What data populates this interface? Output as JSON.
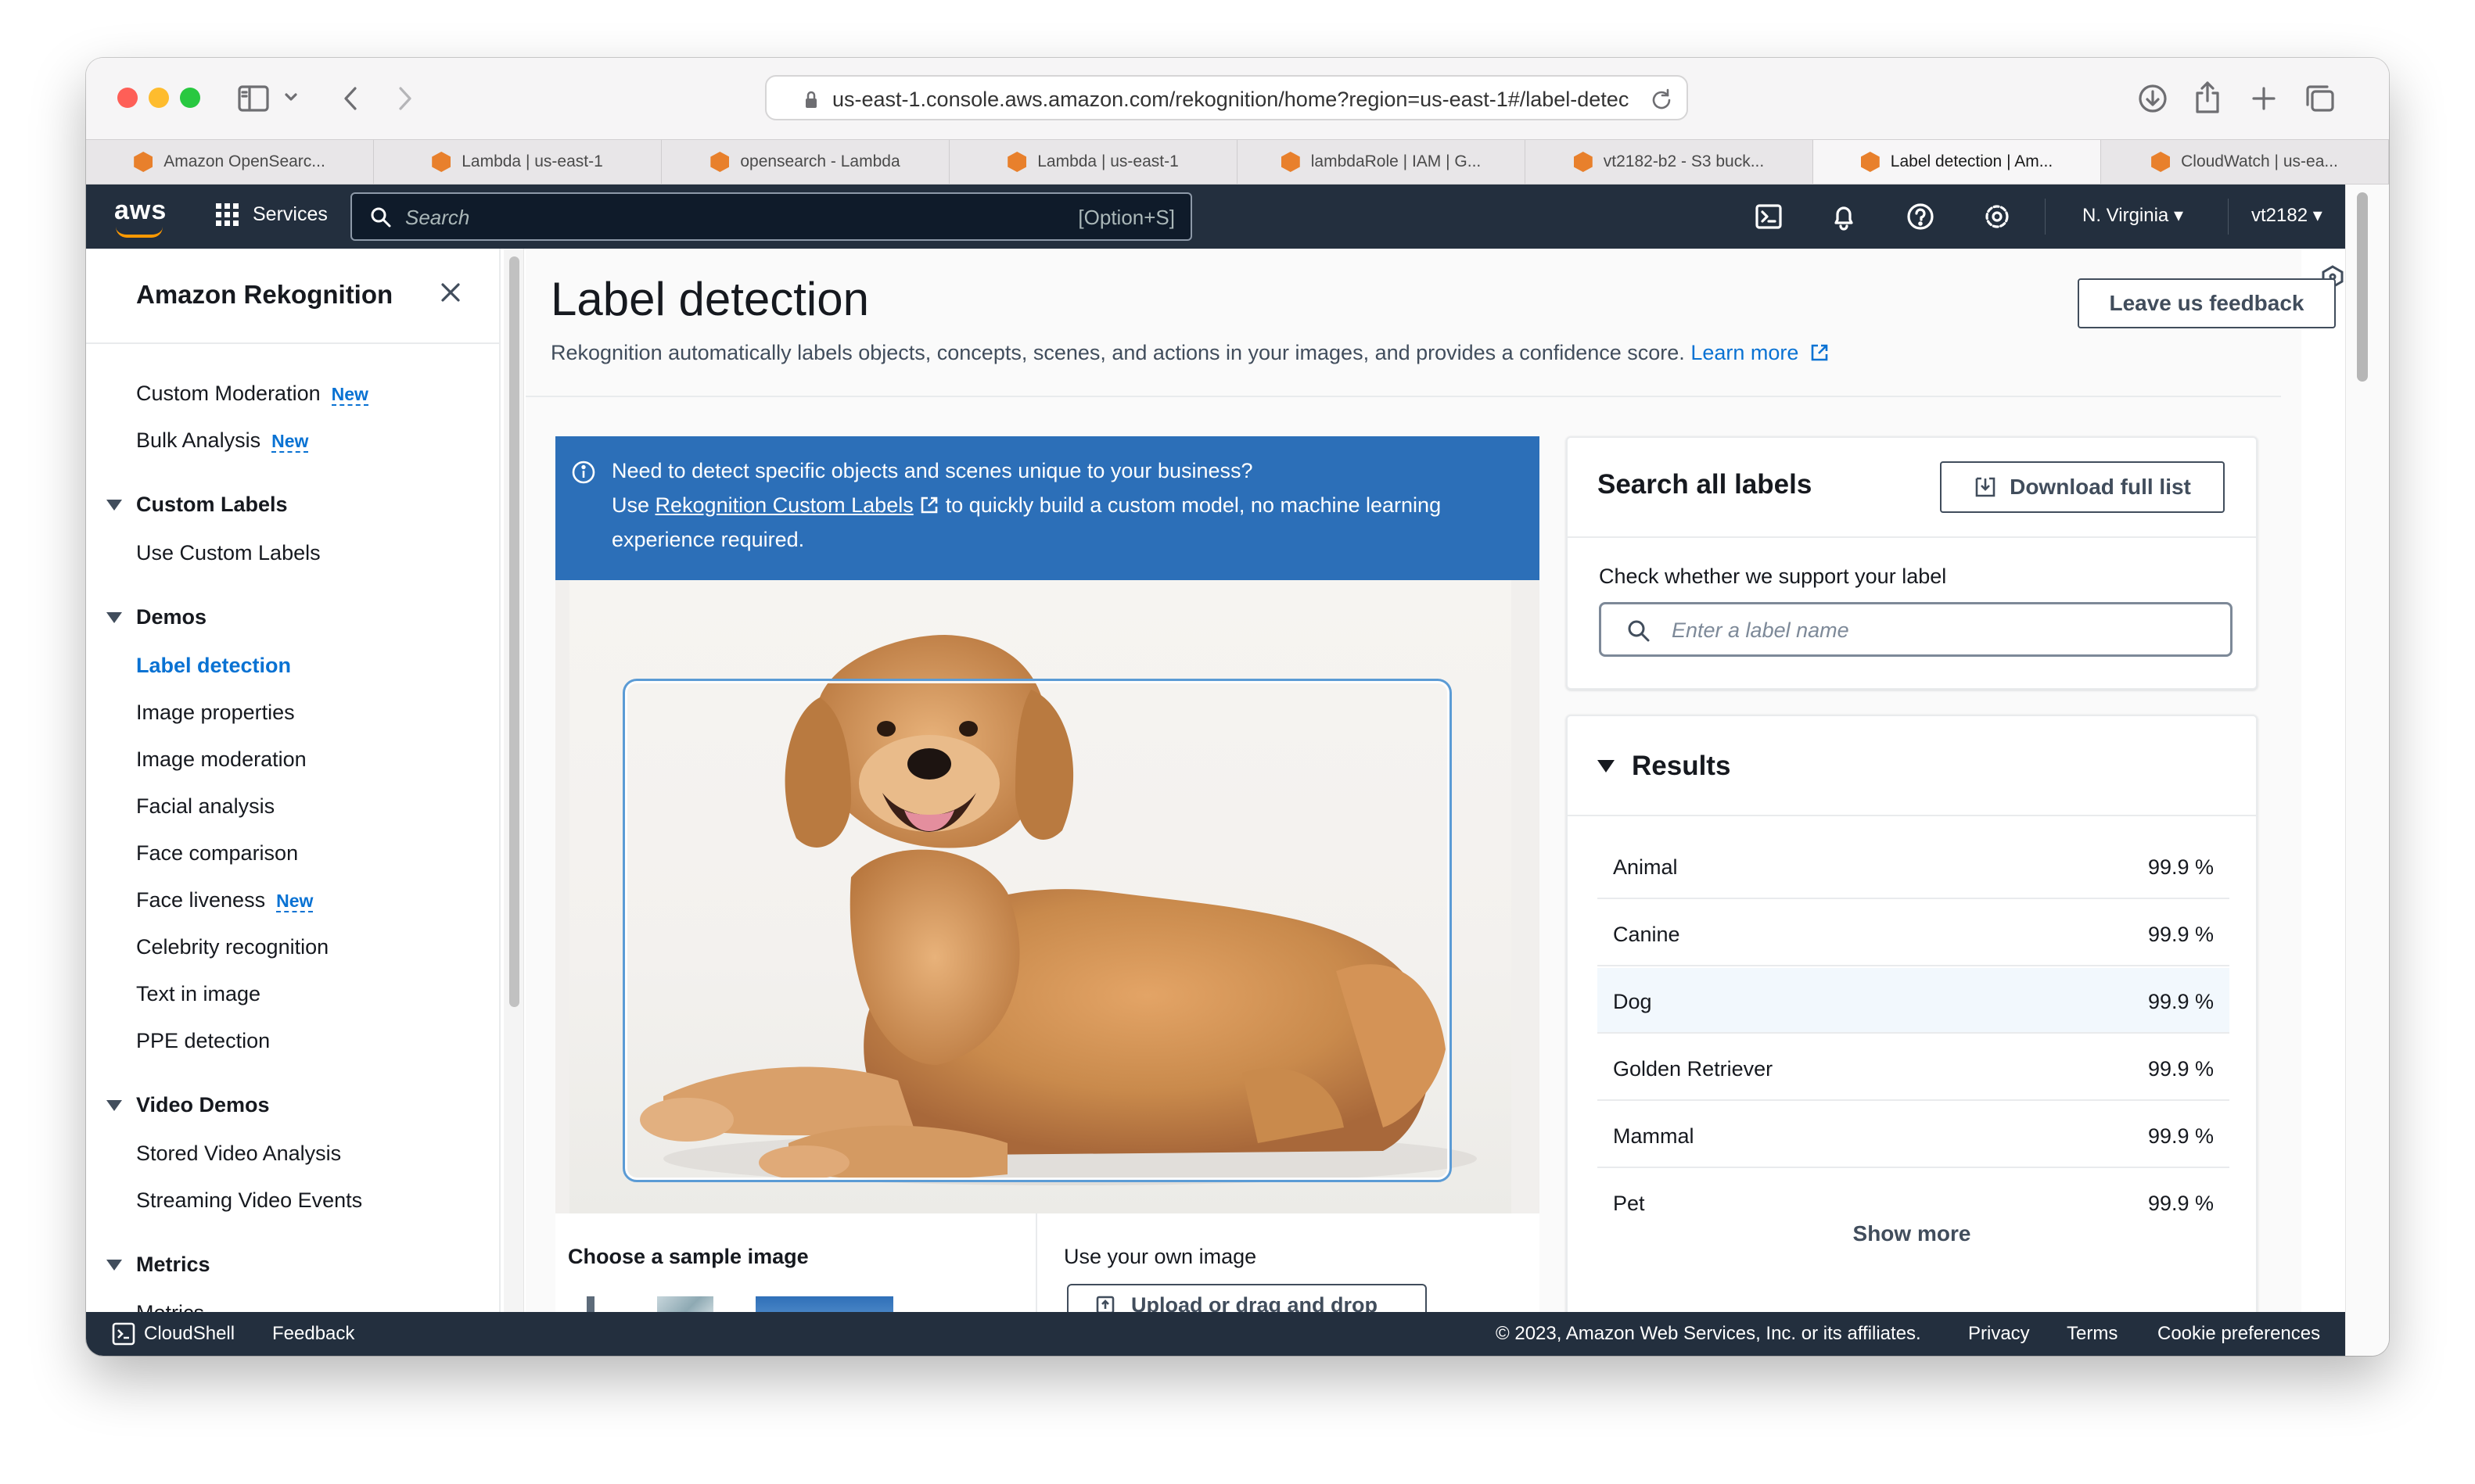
{
  "browser": {
    "url": "us-east-1.console.aws.amazon.com/rekognition/home?region=us-east-1#/label-detec",
    "tabs": [
      {
        "label": "Amazon OpenSearc..."
      },
      {
        "label": "Lambda | us-east-1"
      },
      {
        "label": "opensearch - Lambda"
      },
      {
        "label": "Lambda | us-east-1"
      },
      {
        "label": "lambdaRole | IAM | G..."
      },
      {
        "label": "vt2182-b2 - S3 buck..."
      },
      {
        "label": "Label detection | Am..."
      },
      {
        "label": "CloudWatch | us-ea..."
      }
    ],
    "active_tab_index": 6
  },
  "aws_nav": {
    "logo": "aws",
    "services_label": "Services",
    "search_placeholder": "Search",
    "search_shortcut": "[Option+S]",
    "region": "N. Virginia",
    "account": "vt2182",
    "icons": [
      "cloudshell-icon",
      "bell-icon",
      "help-icon",
      "settings-icon"
    ]
  },
  "sidebar": {
    "title": "Amazon Rekognition",
    "items_top": [
      {
        "label": "Custom Moderation",
        "badge": "New"
      },
      {
        "label": "Bulk Analysis",
        "badge": "New"
      }
    ],
    "sections": [
      {
        "heading": "Custom Labels",
        "items": [
          {
            "label": "Use Custom Labels"
          }
        ]
      },
      {
        "heading": "Demos",
        "items": [
          {
            "label": "Label detection",
            "active": true
          },
          {
            "label": "Image properties"
          },
          {
            "label": "Image moderation"
          },
          {
            "label": "Facial analysis"
          },
          {
            "label": "Face comparison"
          },
          {
            "label": "Face liveness",
            "badge": "New"
          },
          {
            "label": "Celebrity recognition"
          },
          {
            "label": "Text in image"
          },
          {
            "label": "PPE detection"
          }
        ]
      },
      {
        "heading": "Video Demos",
        "items": [
          {
            "label": "Stored Video Analysis"
          },
          {
            "label": "Streaming Video Events"
          }
        ]
      },
      {
        "heading": "Metrics",
        "items": [
          {
            "label": "Metrics"
          }
        ]
      }
    ]
  },
  "page": {
    "title": "Label detection",
    "description": "Rekognition automatically labels objects, concepts, scenes, and actions in your images, and provides a confidence score.",
    "learn_more": "Learn more",
    "feedback_button": "Leave us feedback"
  },
  "info_banner": {
    "line1": "Need to detect specific objects and scenes unique to your business?",
    "line2_pre": "Use",
    "line2_link": "Rekognition Custom Labels",
    "line2_post": "to quickly build a custom model, no machine learning",
    "line3": "experience required."
  },
  "sample_section": {
    "choose_label": "Choose a sample image",
    "own_label": "Use your own image",
    "upload_button": "Upload or drag and drop"
  },
  "search_card": {
    "title": "Search all labels",
    "download_button": "Download full list",
    "check_label": "Check whether we support your label",
    "input_placeholder": "Enter a label name"
  },
  "results": {
    "title": "Results",
    "rows": [
      {
        "name": "Animal",
        "confidence": "99.9 %"
      },
      {
        "name": "Canine",
        "confidence": "99.9 %"
      },
      {
        "name": "Dog",
        "confidence": "99.9 %"
      },
      {
        "name": "Golden Retriever",
        "confidence": "99.9 %"
      },
      {
        "name": "Mammal",
        "confidence": "99.9 %"
      },
      {
        "name": "Pet",
        "confidence": "99.9 %"
      }
    ],
    "show_more": "Show more"
  },
  "footer": {
    "cloudshell": "CloudShell",
    "feedback": "Feedback",
    "copyright": "© 2023, Amazon Web Services, Inc. or its affiliates.",
    "privacy": "Privacy",
    "terms": "Terms",
    "cookies": "Cookie preferences"
  },
  "colors": {
    "aws_nav_bg": "#232f3e",
    "aws_orange": "#ff9900",
    "link_blue": "#0972d3",
    "info_banner_bg": "#2c6fb8",
    "bbox_blue": "#5b9bd5"
  }
}
